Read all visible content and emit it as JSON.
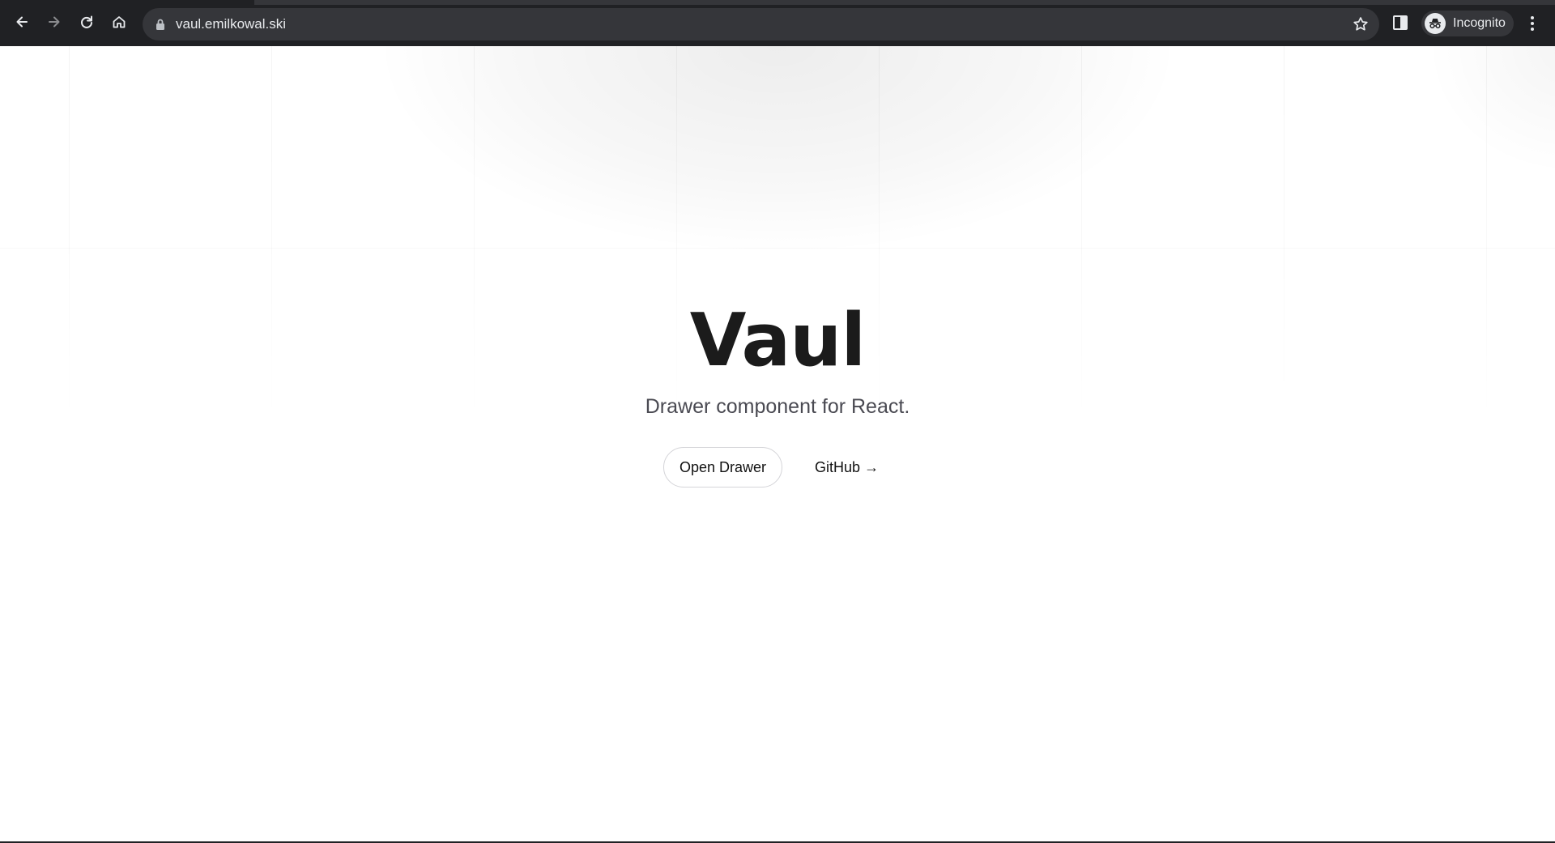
{
  "browser": {
    "url": "vaul.emilkowal.ski",
    "profile_label": "Incognito",
    "icons": {
      "back": "arrow-left-icon",
      "forward": "arrow-right-icon",
      "reload": "reload-icon",
      "home": "home-icon",
      "lock": "lock-icon",
      "bookmark": "star-icon",
      "side_panel": "side-panel-icon",
      "incognito": "incognito-icon",
      "menu": "kebab-menu-icon"
    },
    "colors": {
      "toolbar": "#202124",
      "omnibox": "#35363a",
      "text": "#e8eaed"
    }
  },
  "hero": {
    "title": "Vaul",
    "subtitle": "Drawer component for React.",
    "open_drawer_label": "Open Drawer",
    "github_label": "GitHub →"
  },
  "colors": {
    "title": "#1b1b1b",
    "subtitle": "#4a4a52",
    "background": "#ffffff"
  }
}
